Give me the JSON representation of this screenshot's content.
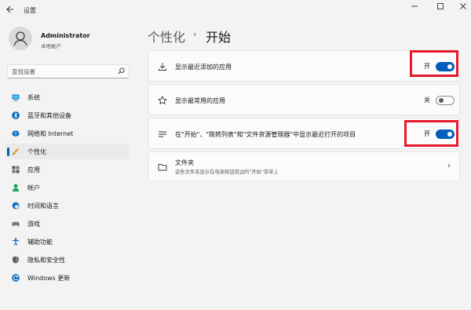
{
  "window": {
    "title": "设置",
    "back_icon": "arrow-left-icon",
    "min_glyph": "—",
    "max_glyph": "☐",
    "close_glyph": "✕"
  },
  "profile": {
    "name": "Administrator",
    "account_type": "本地帐户"
  },
  "search": {
    "placeholder": "查找设置",
    "icon": "search-icon"
  },
  "sidebar": {
    "items": [
      {
        "label": "系统",
        "icon": "monitor-icon",
        "active": false
      },
      {
        "label": "蓝牙和其他设备",
        "icon": "bluetooth-icon",
        "active": false
      },
      {
        "label": "网络和 Internet",
        "icon": "wifi-icon",
        "active": false
      },
      {
        "label": "个性化",
        "icon": "pen-icon",
        "active": true
      },
      {
        "label": "应用",
        "icon": "apps-icon",
        "active": false
      },
      {
        "label": "帐户",
        "icon": "person-icon",
        "active": false
      },
      {
        "label": "时间和语言",
        "icon": "globe-clock-icon",
        "active": false
      },
      {
        "label": "游戏",
        "icon": "gamepad-icon",
        "active": false
      },
      {
        "label": "辅助功能",
        "icon": "accessibility-icon",
        "active": false
      },
      {
        "label": "隐私和安全性",
        "icon": "shield-icon",
        "active": false
      },
      {
        "label": "Windows 更新",
        "icon": "update-icon",
        "active": false
      }
    ]
  },
  "breadcrumb": {
    "parent": "个性化",
    "separator": "›",
    "current": "开始"
  },
  "settings": [
    {
      "label": "显示最近添加的应用",
      "icon": "download-icon",
      "state_label": "开",
      "on": true,
      "highlighted": true
    },
    {
      "label": "显示最常用的应用",
      "icon": "star-icon",
      "state_label": "关",
      "on": false,
      "highlighted": false
    },
    {
      "label": "在\"开始\"、\"跳转列表\"和\"文件资源管理器\"中显示最近打开的项目",
      "icon": "list-icon",
      "state_label": "开",
      "on": true,
      "highlighted": true
    },
    {
      "label": "文件夹",
      "description": "这些文件夹显示在电源按钮旁边的\"开始\"菜单上",
      "icon": "folder-icon",
      "chevron": "›"
    }
  ],
  "colors": {
    "accent": "#005fb8",
    "highlight": "#e8192c",
    "background": "#f3f3f3",
    "card": "#fbfbfb"
  }
}
